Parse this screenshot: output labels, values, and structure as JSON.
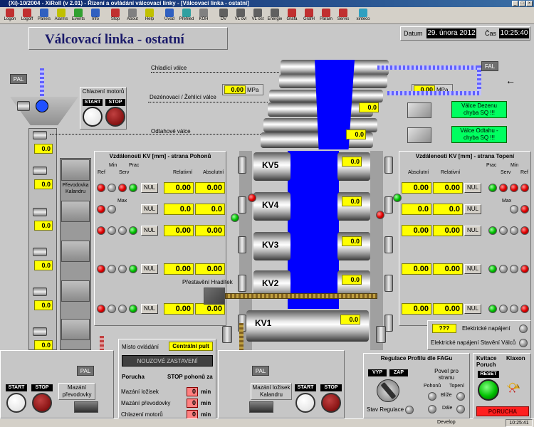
{
  "window": {
    "title": "(Xi)-10/2004 - XiRoll (v 2.01) - Řízení a ovládání válcovací linky - [Válcovací linka - ostatní]"
  },
  "toolbar": [
    {
      "label": "Logon",
      "color": "#c03030"
    },
    {
      "label": "Logoff",
      "color": "#c03030"
    },
    {
      "label": "Panels",
      "color": "#3060c0"
    },
    {
      "label": "Alarms",
      "color": "#c0c000"
    },
    {
      "label": "Events",
      "color": "#30a030"
    },
    {
      "label": "Info",
      "color": "#3060c0"
    },
    {
      "label": "Stop",
      "color": "#c03030"
    },
    {
      "label": "About",
      "color": "#808080"
    },
    {
      "label": "Help",
      "color": "#c0c000"
    },
    {
      "label": "Úvod",
      "color": "#3060c0"
    },
    {
      "label": "Přehled",
      "color": "#30a0a0"
    },
    {
      "label": "KOH",
      "color": "#808080"
    },
    {
      "label": "DV",
      "color": "#606060"
    },
    {
      "label": "VL ovl",
      "color": "#606060"
    },
    {
      "label": "VL ost",
      "color": "#606060"
    },
    {
      "label": "Energie",
      "color": "#606060"
    },
    {
      "label": "Grafa",
      "color": "#c03030"
    },
    {
      "label": "GrafH",
      "color": "#c03030"
    },
    {
      "label": "Param",
      "color": "#c03030"
    },
    {
      "label": "Servis",
      "color": "#c03030"
    },
    {
      "label": "xinteco",
      "color": "#30a0c0"
    }
  ],
  "header": {
    "title": "Válcovací linka - ostatní",
    "date_label": "Datum",
    "date": "29. února 2012",
    "time_label": "Čas",
    "time": "10:25:40"
  },
  "cooling": {
    "pal": "PAL",
    "title": "Chlazení motorů",
    "start": "START",
    "stop": "STOP"
  },
  "labels": {
    "chladici": "Chladící válce",
    "dezen": "Dezénovací / Žehlící válce",
    "odtah": "Odtahové válce",
    "pressure1": "0.00",
    "mpa1": "MPa",
    "pressure2": "0.00",
    "mpa2": "MPa",
    "v1": "0.0",
    "v2": "0.0",
    "fal_right": "FAL",
    "msg_dezen": "Válce Dezenu\nchyba SQ !!!",
    "msg_odtah": "Válce Odtahu -\nchyba SQ !!!"
  },
  "left_column": {
    "values": [
      "0.0",
      "0.0",
      "0.0",
      "0.0",
      "0.0",
      "0.0"
    ],
    "prevodovka": "Převodovka\nKalandru"
  },
  "left_panel": {
    "title": "Vzdálenosti KV [mm] - strana Pohonů",
    "h_ref": "Ref",
    "h_min": "Min",
    "h_serv": "Serv",
    "h_prac": "Prac",
    "h_rel": "Relativní",
    "h_abs": "Absolutní",
    "max": "Max",
    "rows": [
      {
        "nul": "NUL",
        "rel": "0.00",
        "abs": "0.00"
      },
      {
        "nul": "NUL",
        "rel": "0.0",
        "abs": "0.0"
      },
      {
        "nul": "NUL",
        "rel": "0.00",
        "abs": "0.00"
      },
      {
        "nul": "NUL",
        "rel": "0.00",
        "abs": "0.00"
      },
      {
        "nul": "NUL",
        "rel": "0.00",
        "abs": "0.00"
      }
    ]
  },
  "right_panel": {
    "title": "Vzdálenosti KV [mm] - strana Topení",
    "h_abs": "Absolutní",
    "h_rel": "Relativní",
    "h_prac": "Prac",
    "h_serv": "Serv",
    "h_min": "Min",
    "h_ref": "Ref",
    "max": "Max",
    "rows": [
      {
        "nul": "NUL",
        "rel": "0.00",
        "abs": "0.00"
      },
      {
        "nul": "NUL",
        "rel": "0.0",
        "abs": "0.0"
      },
      {
        "nul": "NUL",
        "rel": "0.00",
        "abs": "0.00"
      },
      {
        "nul": "NUL",
        "rel": "0.00",
        "abs": "0.00"
      },
      {
        "nul": "NUL",
        "rel": "0.00",
        "abs": "0.00"
      }
    ]
  },
  "rolls": [
    {
      "name": "KV5",
      "value": "0.0"
    },
    {
      "name": "KV4",
      "value": "0.0"
    },
    {
      "name": "KV3",
      "value": "0.0"
    },
    {
      "name": "KV2",
      "value": "0.0"
    },
    {
      "name": "KV1",
      "value": "0.0"
    }
  ],
  "prestaveni": "Přestavění Hradítek",
  "bottom_left": {
    "pal": "PAL",
    "start": "START",
    "stop": "STOP",
    "mazani": "Mazání\npřevodovky"
  },
  "control": {
    "misto_label": "Místo ovládání",
    "misto_value": "Centrální pult",
    "nouzove": "NOUZOVÉ ZASTAVENÍ",
    "porucha": "Porucha",
    "stop_pohonu": "STOP pohonů za",
    "rows": [
      {
        "label": "Mazání ložisek",
        "val": "0",
        "unit": "min"
      },
      {
        "label": "Mazání převodovky",
        "val": "0",
        "unit": "min"
      },
      {
        "label": "Chlazení motorů",
        "val": "0",
        "unit": "min"
      }
    ]
  },
  "bottom_mid": {
    "pal": "PAL",
    "mazani": "Mazání ložisek\nKalandru",
    "start": "START",
    "stop": "STOP"
  },
  "energy": {
    "q": "???",
    "el_nap": "Elektrické napájení",
    "el_nap_st": "Elektrické napájení Stavění Válců"
  },
  "regulace": {
    "title": "Regulace Profilu dle FAGu",
    "vyp": "VYP",
    "zap": "ZAP",
    "stav": "Stav Regulace",
    "povel": "Povel pro\nstranu",
    "pohonu": "Pohonů",
    "topeni": "Topení",
    "blize": "Blíže",
    "dale": "Dále"
  },
  "kvitace": {
    "title": "Kvitace\nPoruch",
    "klaxon": "Klaxon",
    "reset": "RESET",
    "porucha": "PORUCHA"
  },
  "status": {
    "develop": "Develop",
    "time": "10:25:41"
  }
}
